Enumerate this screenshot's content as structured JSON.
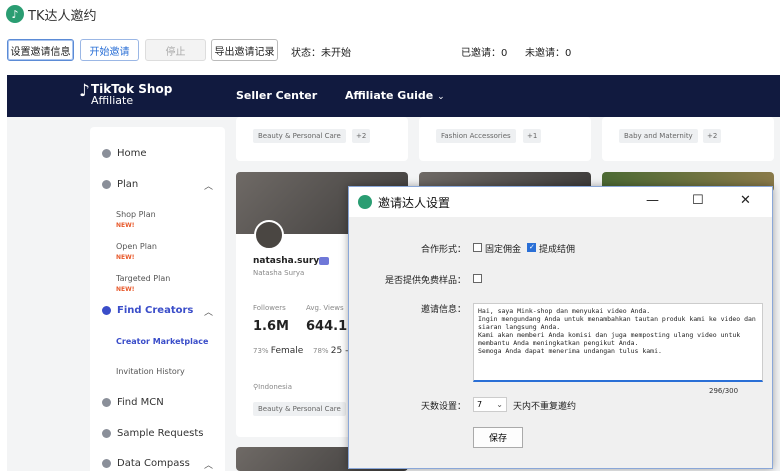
{
  "app": {
    "title": "TK达人邀约"
  },
  "toolbar": {
    "btn_settings": "设置邀请信息",
    "btn_start": "开始邀请",
    "btn_stop": "停止",
    "btn_export": "导出邀请记录",
    "status_label": "状态：",
    "status_value": "未开始",
    "invited_label": "已邀请：",
    "invited_value": "0",
    "uninvited_label": "未邀请：",
    "uninvited_value": "0"
  },
  "site": {
    "brand_line1": "TikTok Shop",
    "brand_line2": "Affiliate",
    "nav_seller": "Seller Center",
    "nav_guide": "Affiliate Guide",
    "sidebar": {
      "home": "Home",
      "plan": "Plan",
      "shop_plan": "Shop Plan",
      "open_plan": "Open Plan",
      "targeted_plan": "Targeted Plan",
      "new_badge": "NEW!",
      "find_creators": "Find Creators",
      "creator_marketplace": "Creator Marketplace",
      "invitation_history": "Invitation History",
      "find_mcn": "Find MCN",
      "sample_requests": "Sample Requests",
      "data_compass": "Data Compass"
    },
    "top_cards": [
      {
        "tag": "Beauty & Personal Care",
        "more": "+2"
      },
      {
        "tag": "Fashion Accessories",
        "more": "+1"
      },
      {
        "tag": "Baby and Maternity",
        "more": "+2"
      }
    ],
    "creator": {
      "name": "natasha.surya",
      "display": "Natasha Surya",
      "followers_label": "Followers",
      "followers": "1.6M",
      "views_label": "Avg. Views",
      "views": "644.1K",
      "female_pct": "73%",
      "female_label": "Female",
      "age_pct": "78%",
      "age": "25 -",
      "country": "Indonesia",
      "tag": "Beauty & Personal Care"
    }
  },
  "dialog": {
    "title": "邀请达人设置",
    "coop_label": "合作形式：",
    "opt_fixed": "固定佣金",
    "opt_commission": "提成结佣",
    "opt_fixed_checked": false,
    "opt_commission_checked": true,
    "sample_label": "是否提供免费样品：",
    "sample_checked": false,
    "msg_label": "邀请信息：",
    "message": "Hai, saya Mink-shop dan menyukai video Anda.\nIngin mengundang Anda untuk menambahkan tautan produk kami ke video dan siaran langsung Anda.\nKami akan memberi Anda komisi dan juga memposting ulang video untuk membantu Anda meningkatkan pengikut Anda.\nSemoga Anda dapat menerima undangan tulus kami.",
    "counter": "296/300",
    "days_label": "天数设置：",
    "days_value": "7",
    "days_suffix": "天内不重复邀约",
    "save": "保存"
  }
}
